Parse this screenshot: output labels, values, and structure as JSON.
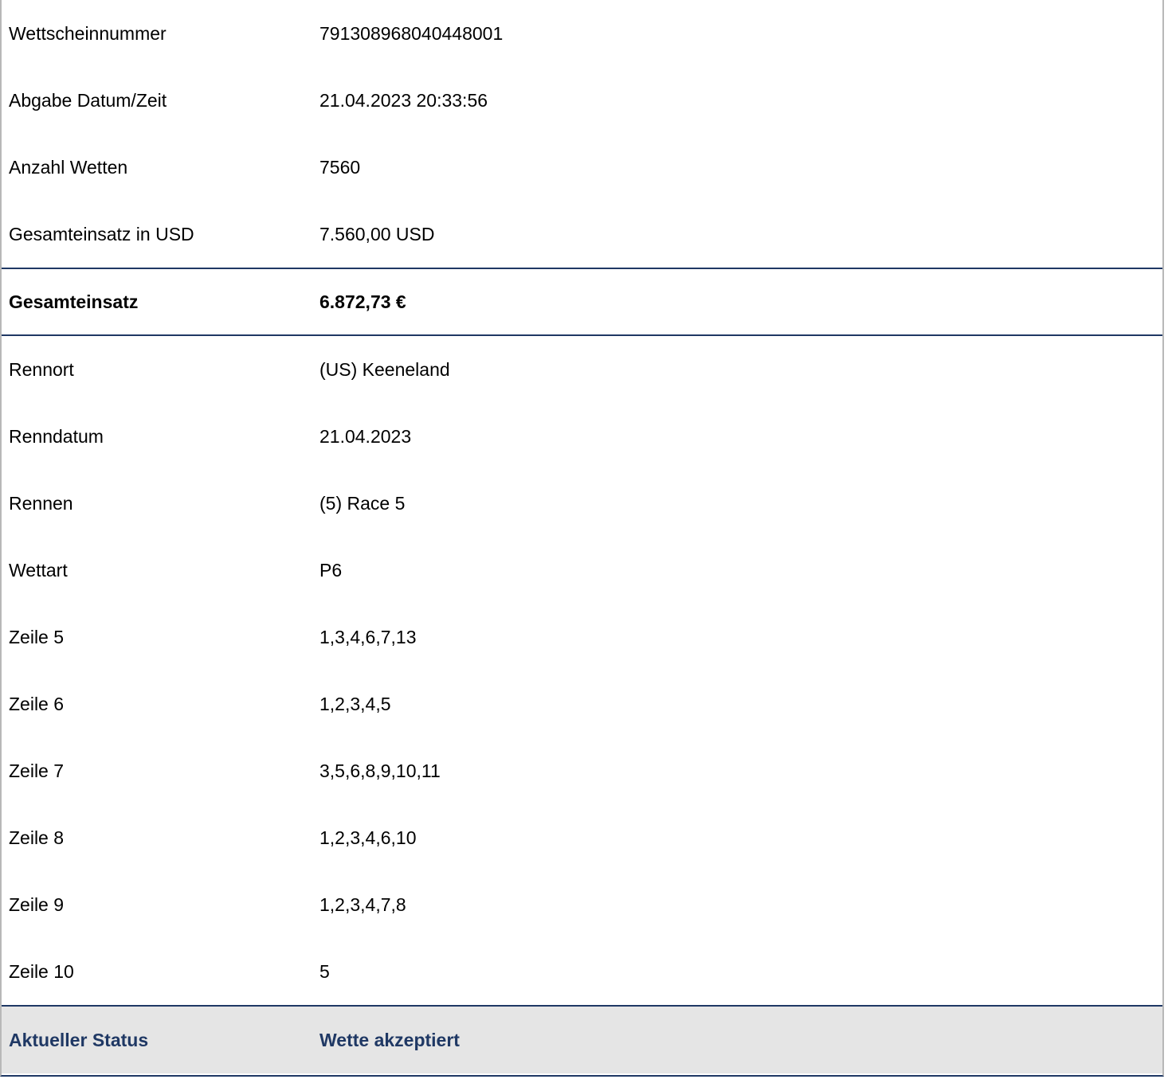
{
  "ticket": {
    "rows_top": [
      {
        "label": "Wettscheinnummer",
        "value": "791308968040448001"
      },
      {
        "label": "Abgabe Datum/Zeit",
        "value": "21.04.2023 20:33:56"
      },
      {
        "label": "Anzahl Wetten",
        "value": "7560"
      },
      {
        "label": "Gesamteinsatz in USD",
        "value": "7.560,00 USD"
      }
    ],
    "total": {
      "label": "Gesamteinsatz",
      "value": "6.872,73 €"
    },
    "rows_race": [
      {
        "label": "Rennort",
        "value": "(US) Keeneland"
      },
      {
        "label": "Renndatum",
        "value": "21.04.2023"
      },
      {
        "label": "Rennen",
        "value": "(5) Race 5"
      },
      {
        "label": "Wettart",
        "value": "P6"
      },
      {
        "label": "Zeile 5",
        "value": "1,3,4,6,7,13"
      },
      {
        "label": "Zeile 6",
        "value": "1,2,3,4,5"
      },
      {
        "label": "Zeile 7",
        "value": "3,5,6,8,9,10,11"
      },
      {
        "label": "Zeile 8",
        "value": "1,2,3,4,6,10"
      },
      {
        "label": "Zeile 9",
        "value": "1,2,3,4,7,8"
      },
      {
        "label": "Zeile 10",
        "value": "5"
      }
    ],
    "status": {
      "label": "Aktueller Status",
      "value": "Wette akzeptiert"
    }
  },
  "colors": {
    "accent_navy": "#1f3864",
    "status_background": "#e5e5e5",
    "side_border": "#b8b8b8"
  }
}
